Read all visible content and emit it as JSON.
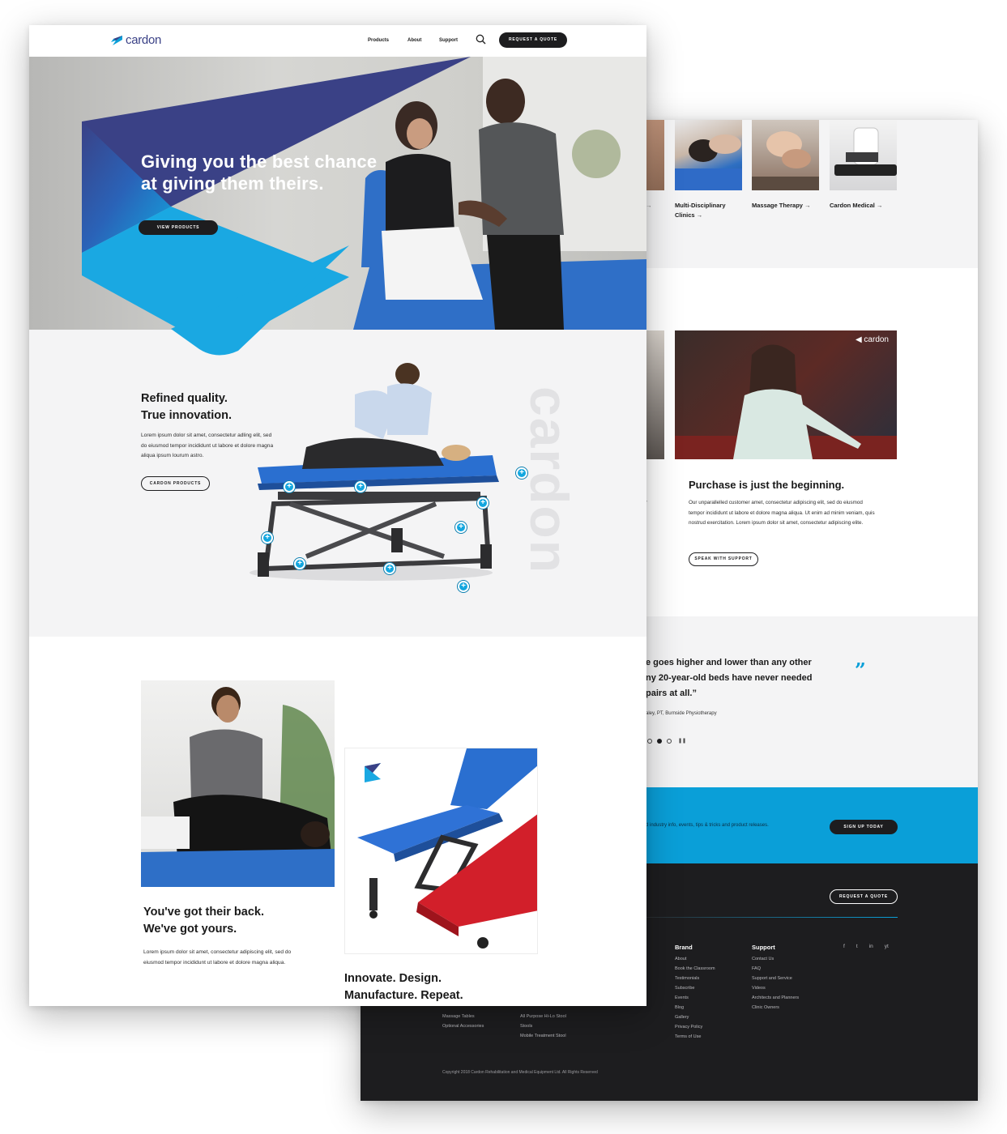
{
  "colors": {
    "brand_blue": "#0a9fd8",
    "navy": "#3a4186",
    "dark": "#1d1d1f",
    "light_bg": "#f4f4f5"
  },
  "header": {
    "logo_text": "cardon",
    "nav": [
      "Products",
      "About",
      "Support"
    ],
    "search_icon": "search-icon",
    "cta_label": "Request a Quote"
  },
  "hero": {
    "headline_line1": "Giving you the best chance",
    "headline_line2": "at giving them theirs.",
    "button_label": "View Products"
  },
  "quality": {
    "title_line1": "Refined quality.",
    "title_line2": "True innovation.",
    "body": "Lorem ipsum dolor sit amet, consectetur adling elit, sed do eiusmod tempor incididunt ut labore et dolore magna aliqua ipsum lourum astro.",
    "button_label": "Cardon Products",
    "watermark": "cardon"
  },
  "back_section": {
    "title_line1": "You've got their back.",
    "title_line2": "We've got yours.",
    "body": "Lorem ipsum dolor sit amet, consectetur adipiscing elit, sed do eiusmod tempor incididunt ut labore et dolore magna aliqua."
  },
  "innovate": {
    "title_line1": "Innovate. Design.",
    "title_line2": "Manufacture. Repeat."
  },
  "categories": [
    {
      "line1": "Multi-Disciplinary",
      "line2": "Clinics →"
    },
    {
      "line1": "Massage Therapy →",
      "line2": ""
    },
    {
      "line1": "Cardon Medical →",
      "line2": ""
    }
  ],
  "purchase": {
    "video_logo": "cardon",
    "title": "Purchase is just the beginning.",
    "body": "Our unparallelled customer amet, consectetur adipiscing elit, sed do eiusmod tempor incididunt ut labore et dolore magna aliqua. Ut enim ad minim veniam, quis nostrud exercitation. Lorem ipsum dolor sit amet, consectetur adipiscing elite.",
    "button_label": "Speak with Support",
    "side_letter": "r"
  },
  "testimonial": {
    "line1": "e goes higher and lower than any other",
    "line2": "ny 20-year-old beds have never needed",
    "line3": "pairs at all.”",
    "author": "aley, PT, Burnside Physiotherapy",
    "quote_mark": "”"
  },
  "newsletter": {
    "text": "d industry info, events, tips & tricks and product releases.",
    "button_label": "Sign Up Today"
  },
  "footer": {
    "quote_button": "Request a Quote",
    "brand_title": "Brand",
    "brand_links": [
      "About",
      "Book the Classroom",
      "Testimonials",
      "Subscribe",
      "Events",
      "Blog",
      "Gallery",
      "Privacy Policy",
      "Terms of Use"
    ],
    "support_title": "Support",
    "support_links": [
      "Contact Us",
      "FAQ",
      "Support and Service",
      "Videos",
      "Architects and Planners",
      "Clinic Owners"
    ],
    "col1_links": [
      "Massage Tables",
      "Optional Accessories"
    ],
    "col2_links": [
      "All Purpose Hi-Lo Stool",
      "Stools",
      "Mobile Treatment Stool"
    ],
    "social": [
      "f",
      "t",
      "in",
      "yt"
    ],
    "copyright": "Copyright 2018 Cardon Rehabilitation and Medical Equipment Ltd. All Rights Reserved"
  }
}
